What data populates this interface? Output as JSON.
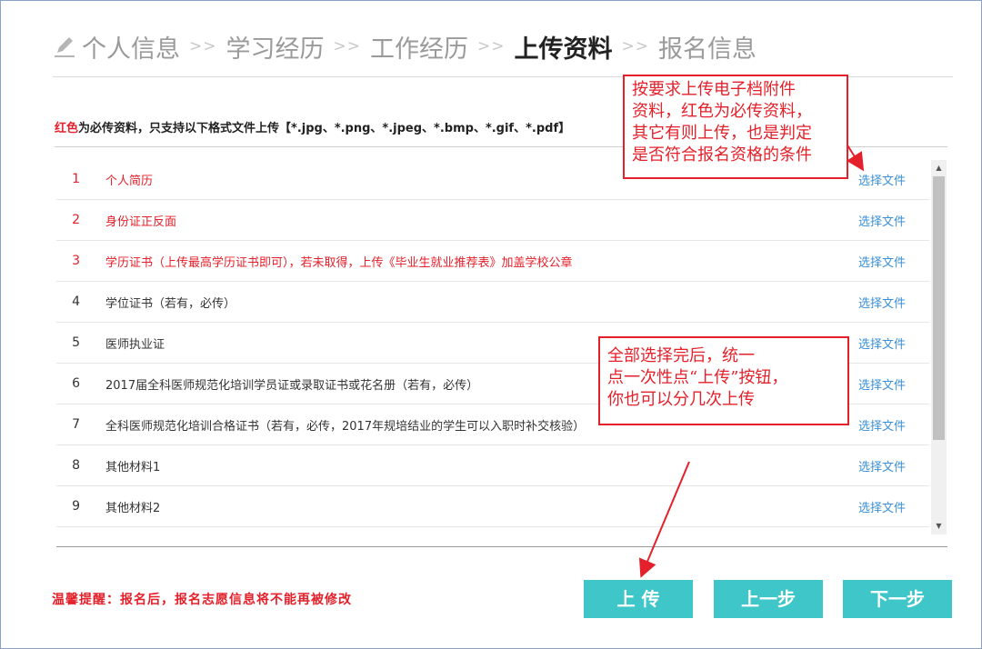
{
  "steps": [
    {
      "label": "个人信息",
      "active": false
    },
    {
      "label": "学习经历",
      "active": false
    },
    {
      "label": "工作经历",
      "active": false
    },
    {
      "label": "上传资料",
      "active": true
    },
    {
      "label": "报名信息",
      "active": false
    }
  ],
  "step_separator": ">>",
  "notice": {
    "red_part": "红色",
    "rest": "为必传资料，只支持以下格式文件上传【*.jpg、*.png、*.jpeg、*.bmp、*.gif、*.pdf】"
  },
  "files": [
    {
      "num": "1",
      "name": "个人简历",
      "required": true,
      "action": "选择文件"
    },
    {
      "num": "2",
      "name": "身份证正反面",
      "required": true,
      "action": "选择文件"
    },
    {
      "num": "3",
      "name": "学历证书（上传最高学历证书即可），若未取得，上传《毕业生就业推荐表》加盖学校公章",
      "required": true,
      "action": "选择文件"
    },
    {
      "num": "4",
      "name": "学位证书（若有，必传）",
      "required": false,
      "action": "选择文件"
    },
    {
      "num": "5",
      "name": "医师执业证",
      "required": false,
      "action": "选择文件"
    },
    {
      "num": "6",
      "name": "2017届全科医师规范化培训学员证或录取证书或花名册（若有，必传）",
      "required": false,
      "action": "选择文件"
    },
    {
      "num": "7",
      "name": "全科医师规范化培训合格证书（若有，必传，2017年规培结业的学生可以入职时补交核验）",
      "required": false,
      "action": "选择文件"
    },
    {
      "num": "8",
      "name": "其他材料1",
      "required": false,
      "action": "选择文件"
    },
    {
      "num": "9",
      "name": "其他材料2",
      "required": false,
      "action": "选择文件"
    }
  ],
  "reminder": "温馨提醒：报名后，报名志愿信息将不能再被修改",
  "buttons": {
    "upload": "上 传",
    "prev": "上一步",
    "next": "下一步"
  },
  "callouts": {
    "top": [
      "按要求上传电子档附件",
      "资料，红色为必传资料，",
      "其它有则上传，也是判定",
      "是否符合报名资格的条件"
    ],
    "middle": [
      "全部选择完后，统一",
      "点一次性点“上传”按钮，",
      "你也可以分几次上传"
    ]
  },
  "colors": {
    "required": "#e4202a",
    "link": "#3a8fd8",
    "button": "#3ec6c8",
    "annotation": "#e4202a"
  },
  "icons": {
    "step": "pencil-icon",
    "scroll_up": "triangle-up-icon",
    "scroll_down": "triangle-down-icon"
  }
}
